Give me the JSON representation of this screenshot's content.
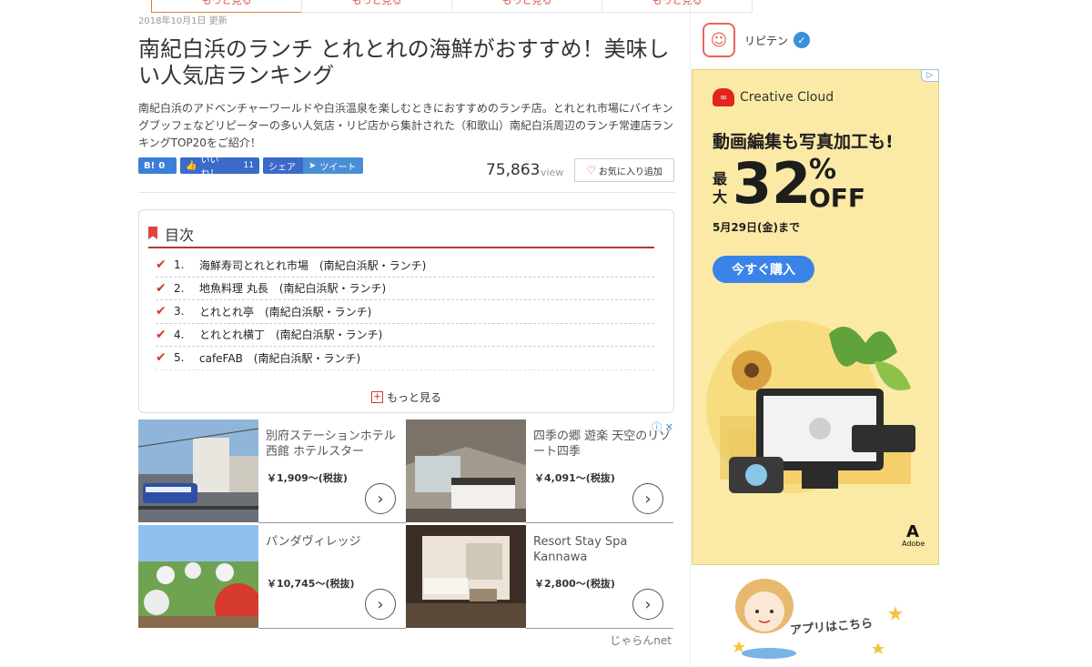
{
  "top_tabs": [
    "もっと見る",
    "もっと見る",
    "もっと見る",
    "もっと見る"
  ],
  "article": {
    "updated": "2018年10月1日 更新",
    "title": "南紀白浜のランチ とれとれの海鮮がおすすめ！美味しい人気店ランキング",
    "description": "南紀白浜のアドベンチャーワールドや白浜温泉を楽しむときにおすすめのランチ店。とれとれ市場にバイキングブッフェなどリピーターの多い人気店・リピ店から集計された（和歌山）南紀白浜周辺のランチ常連店ランキングTOP20をご紹介！",
    "views": "75,863",
    "views_label": "view",
    "fav_label": "お気に入り追加"
  },
  "share": {
    "hatena_label": "B!",
    "hatena_count": "0",
    "like_label": "いいね！",
    "like_count": "11",
    "share_label": "シェア",
    "tweet_label": "ツイート"
  },
  "toc": {
    "title": "目次",
    "items": [
      {
        "num": "1.",
        "label": "海鮮寿司とれとれ市場　(南紀白浜駅・ランチ)"
      },
      {
        "num": "2.",
        "label": "地魚料理 丸長　(南紀白浜駅・ランチ)"
      },
      {
        "num": "3.",
        "label": "とれとれ亭　(南紀白浜駅・ランチ)"
      },
      {
        "num": "4.",
        "label": "とれとれ横丁　(南紀白浜駅・ランチ)"
      },
      {
        "num": "5.",
        "label": "cafeFAB　(南紀白浜駅・ランチ)"
      }
    ],
    "more_label": "もっと見る"
  },
  "hotels": [
    {
      "name": "別府ステーションホテル 西館 ホテルスター",
      "price": "￥1,909～(税抜)"
    },
    {
      "name": "四季の郷 遊楽 天空のリゾート四季",
      "price": "￥4,091～(税抜)"
    },
    {
      "name": "パンダヴィレッジ",
      "price": "￥10,745～(税抜)"
    },
    {
      "name": "Resort Stay Spa Kannawa",
      "price": "￥2,800～(税抜)"
    }
  ],
  "hotel_source": "じゃらんnet",
  "sidebar": {
    "brand_name": "リピテン",
    "ad": {
      "brand": "Creative Cloud",
      "headline": "動画編集も写真加工も!",
      "max_label": "最大",
      "discount": "32",
      "pct": "%",
      "off": "OFF",
      "until": "5月29日(金)まで",
      "cta": "今すぐ購入",
      "adobe": "Adobe"
    },
    "app_banner": "アプリはこちら"
  },
  "colors": {
    "accent_red": "#d9362b",
    "share_blue": "#3b6ac9",
    "ad_yellow": "#fbeaa5",
    "cta_blue": "#3a84e8"
  }
}
